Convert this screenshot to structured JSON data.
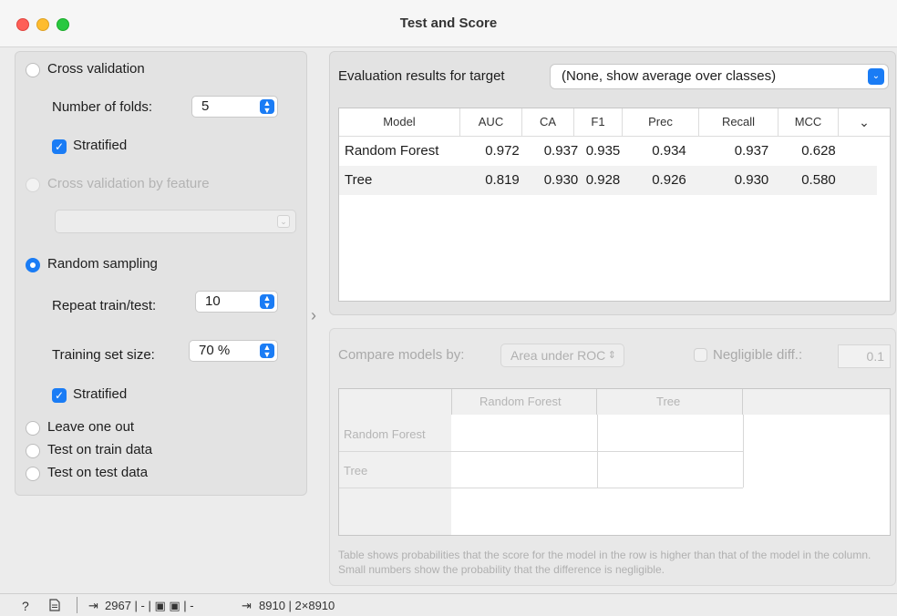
{
  "window": {
    "title": "Test and Score"
  },
  "sampling": {
    "cross_validation": {
      "label": "Cross validation",
      "folds_label": "Number of folds:",
      "folds_value": "5",
      "stratified_label": "Stratified",
      "stratified_checked": true
    },
    "cv_by_feature": {
      "label": "Cross validation by feature",
      "enabled": false
    },
    "random_sampling": {
      "label": "Random sampling",
      "selected": true,
      "repeat_label": "Repeat train/test:",
      "repeat_value": "10",
      "training_size_label": "Training set size:",
      "training_size_value": "70 %",
      "stratified_label": "Stratified",
      "stratified_checked": true
    },
    "leave_one_out": {
      "label": "Leave one out"
    },
    "train_data": {
      "label": "Test on train data"
    },
    "test_data": {
      "label": "Test on test data"
    }
  },
  "evaluation": {
    "target_label": "Evaluation results for target",
    "target_value": "(None, show average over classes)",
    "columns": [
      "Model",
      "AUC",
      "CA",
      "F1",
      "Prec",
      "Recall",
      "MCC"
    ],
    "rows": [
      {
        "model": "Random Forest",
        "auc": "0.972",
        "ca": "0.937",
        "f1": "0.935",
        "prec": "0.934",
        "recall": "0.937",
        "mcc": "0.628"
      },
      {
        "model": "Tree",
        "auc": "0.819",
        "ca": "0.930",
        "f1": "0.928",
        "prec": "0.926",
        "recall": "0.930",
        "mcc": "0.580"
      }
    ]
  },
  "comparison": {
    "compare_label": "Compare models by:",
    "compare_value": "Area under ROC",
    "negligible_label": "Negligible diff.:",
    "negligible_value": "0.1",
    "col_headers": [
      "Random Forest",
      "Tree"
    ],
    "row_headers": [
      "Random Forest",
      "Tree"
    ],
    "footnote": "Table shows probabilities that the score for the model in the row is higher than that of the model in the column. Small numbers show the probability that the difference is negligible."
  },
  "statusbar": {
    "input_summary": "2967 | - | ",
    "input_tail": " | -",
    "output_summary": "8910 | 2×8910"
  }
}
